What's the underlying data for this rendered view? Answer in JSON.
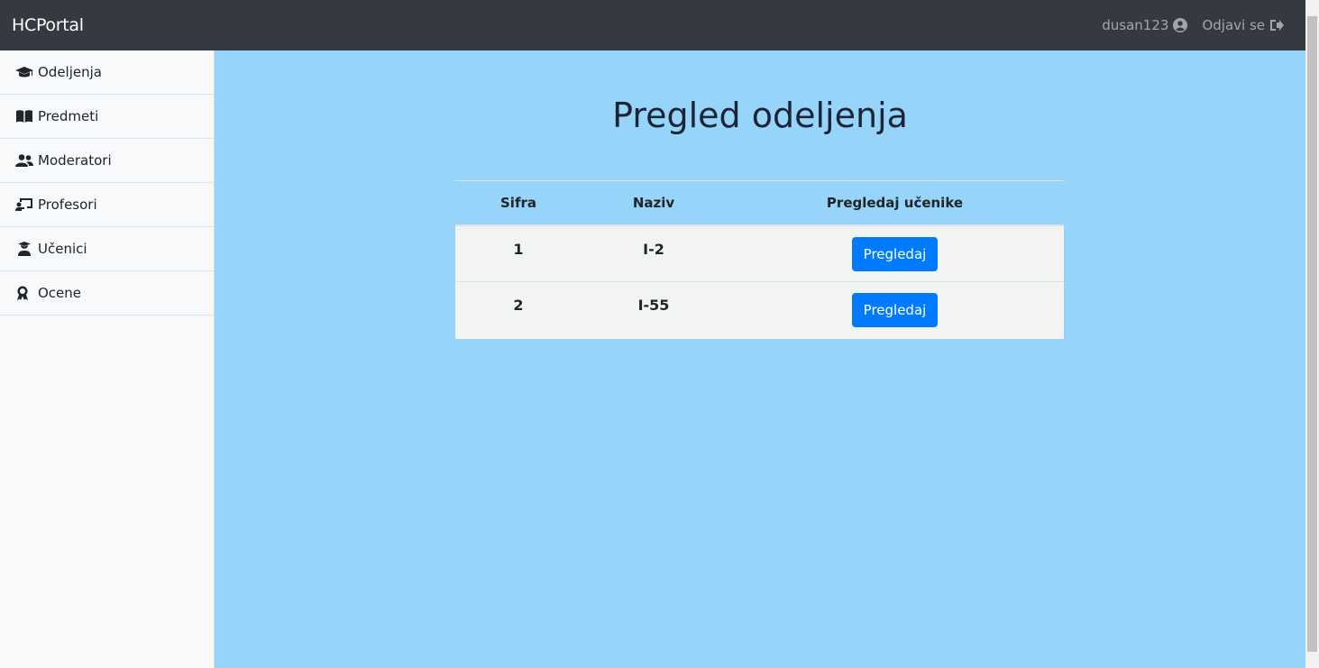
{
  "app": {
    "brand": "HCPortal",
    "user": "dusan123",
    "logout": "Odjavi se"
  },
  "sidebar": {
    "items": [
      {
        "label": "Odeljenja",
        "icon": "graduation-cap-icon"
      },
      {
        "label": "Predmeti",
        "icon": "book-open-icon"
      },
      {
        "label": "Moderatori",
        "icon": "users-icon"
      },
      {
        "label": "Profesori",
        "icon": "chalkboard-teacher-icon"
      },
      {
        "label": "Učenici",
        "icon": "user-graduate-icon"
      },
      {
        "label": "Ocene",
        "icon": "award-icon"
      }
    ]
  },
  "main": {
    "title": "Pregled odeljenja",
    "table": {
      "headers": [
        "Sifra",
        "Naziv",
        "Pregledaj učenike"
      ],
      "rows": [
        {
          "sifra": "1",
          "naziv": "I-2",
          "action": "Pregledaj"
        },
        {
          "sifra": "2",
          "naziv": "I-55",
          "action": "Pregledaj"
        }
      ]
    }
  },
  "colors": {
    "navbar": "#343a40",
    "content_bg": "#97d4fa",
    "primary": "#007bff"
  }
}
